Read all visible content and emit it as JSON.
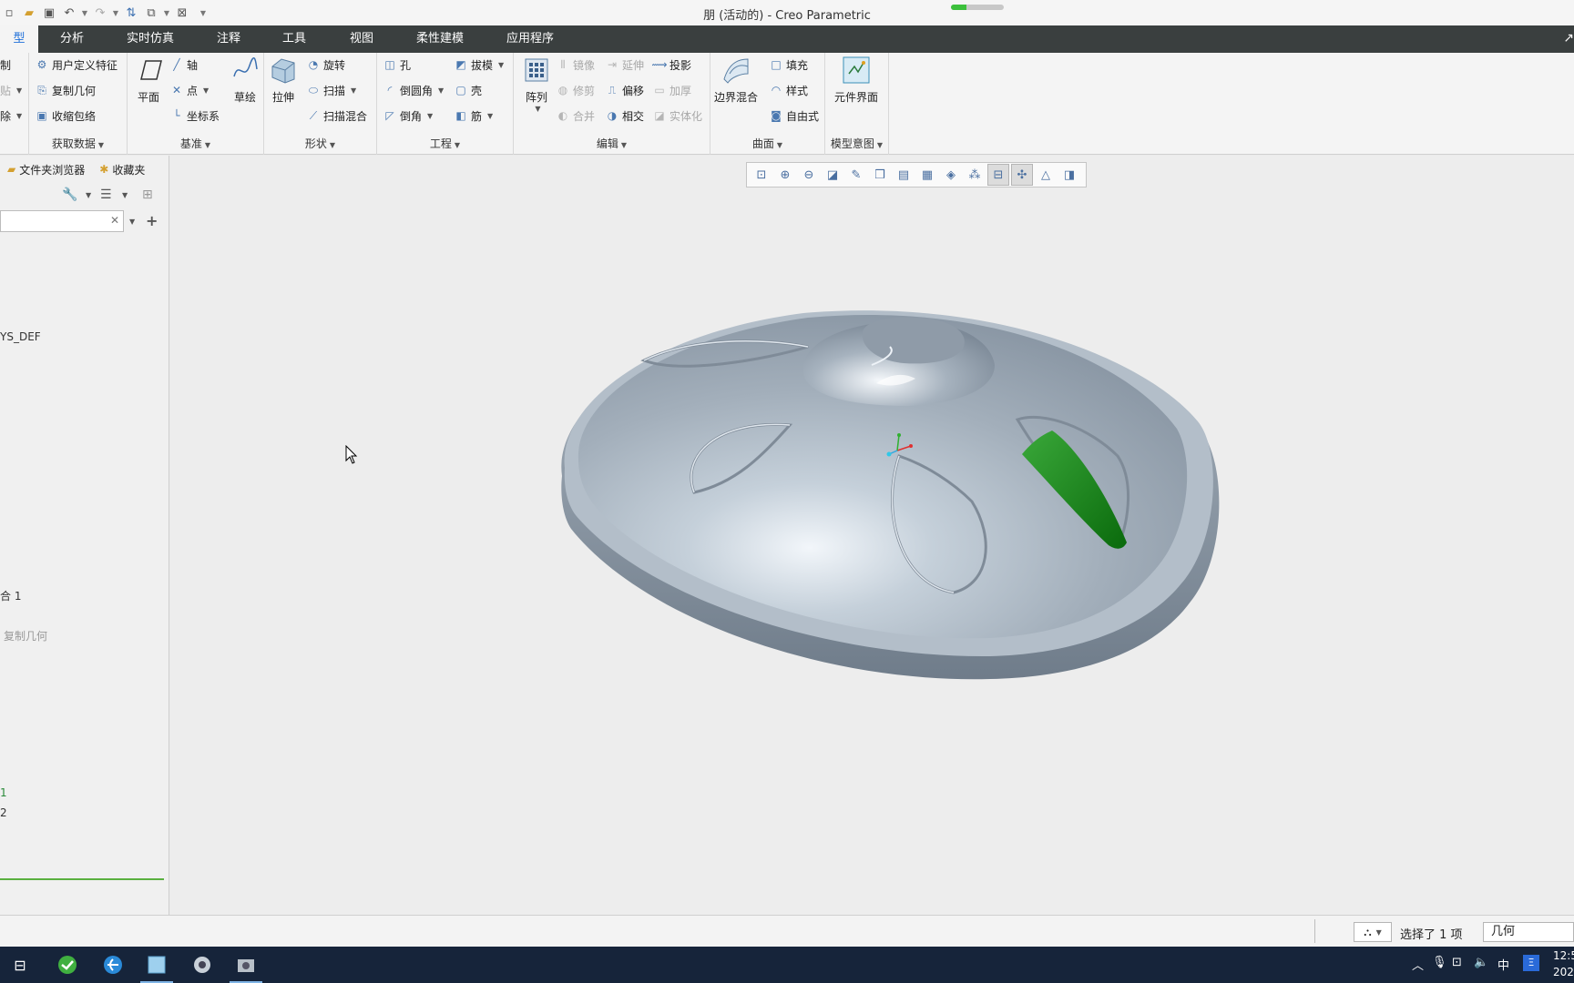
{
  "window": {
    "title": "朋 (活动的) - Creo Parametric",
    "progress": 0.3
  },
  "tabs": [
    {
      "label": "模型",
      "shown": "型",
      "active": true
    },
    {
      "label": "分析"
    },
    {
      "label": "实时仿真"
    },
    {
      "label": "注释"
    },
    {
      "label": "工具"
    },
    {
      "label": "视图"
    },
    {
      "label": "柔性建模"
    },
    {
      "label": "应用程序"
    }
  ],
  "ribbon": {
    "operations": {
      "items": [
        "制",
        "贴",
        "除"
      ]
    },
    "get_data": {
      "label": "获取数据",
      "items": [
        "用户定义特征",
        "复制几何",
        "收缩包络"
      ]
    },
    "datum": {
      "label": "基准",
      "plane": "平面",
      "sketch": "草绘",
      "items": [
        "轴",
        "点",
        "坐标系"
      ]
    },
    "shapes": {
      "label": "形状",
      "extrude": "拉伸",
      "items": [
        "旋转",
        "扫描",
        "扫描混合"
      ]
    },
    "engineering": {
      "label": "工程",
      "items": [
        "孔",
        "倒圆角",
        "倒角",
        "拔模",
        "壳",
        "筋"
      ]
    },
    "editing": {
      "label": "编辑",
      "pattern": "阵列",
      "items": [
        "镜像",
        "修剪",
        "合并",
        "延伸",
        "偏移",
        "相交",
        "投影",
        "加厚",
        "实体化"
      ]
    },
    "surfaces": {
      "label": "曲面",
      "boundary": "边界混合",
      "items": [
        "填充",
        "样式",
        "自由式"
      ]
    },
    "model_intent": {
      "label": "模型意图",
      "interface": "元件界面"
    }
  },
  "left_panel": {
    "tabs": [
      "文件夹浏览器",
      "收藏夹"
    ],
    "tree": [
      "YS_DEF",
      "合 1",
      "复制几何",
      "1",
      "2"
    ]
  },
  "status": {
    "selection": "选择了 1 项",
    "filter": "几何"
  },
  "clock": {
    "time": "12:5",
    "date": "202"
  },
  "tray": {
    "ime": "中"
  },
  "colors": {
    "accent_tab_text": "#1e6fd9",
    "tabbar_bg": "#3a3f3f",
    "highlight_surface": "#0f7a12",
    "model_gray": "#a4afba"
  }
}
